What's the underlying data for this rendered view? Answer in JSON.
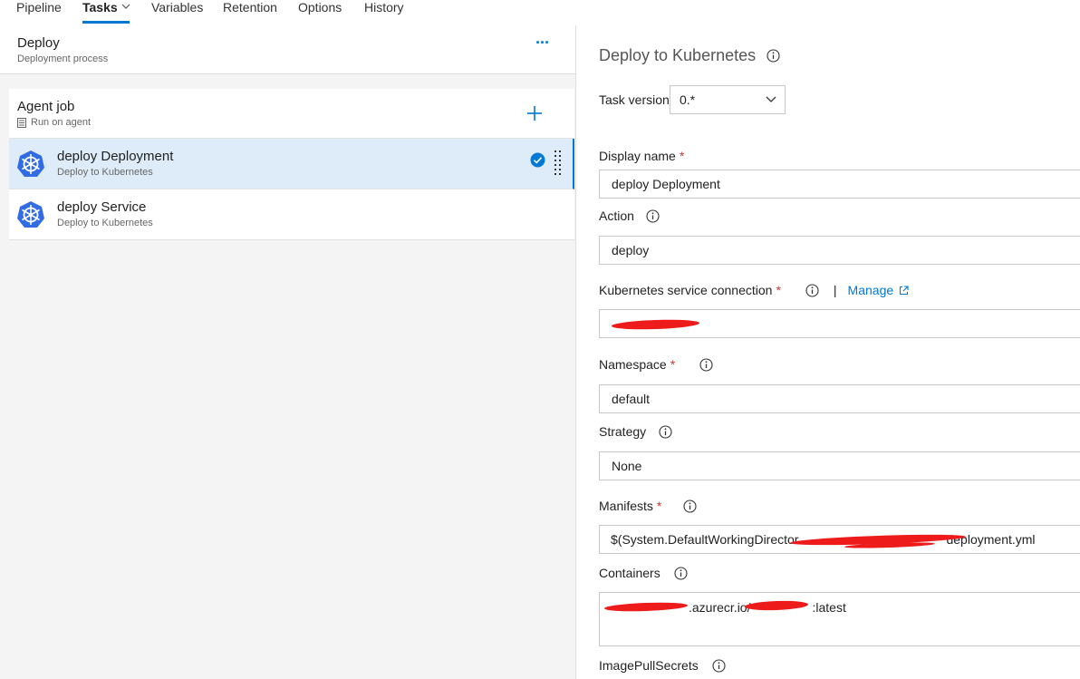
{
  "tabs": [
    {
      "label": "Pipeline",
      "active": false
    },
    {
      "label": "Tasks",
      "active": true
    },
    {
      "label": "Variables",
      "active": false
    },
    {
      "label": "Retention",
      "active": false
    },
    {
      "label": "Options",
      "active": false
    },
    {
      "label": "History",
      "active": false
    }
  ],
  "left": {
    "stage_title": "Deploy",
    "stage_subtitle": "Deployment process",
    "more_label": "···",
    "job": {
      "title": "Agent job",
      "subtitle": "Run on agent"
    },
    "tasks": [
      {
        "title": "deploy Deployment",
        "subtitle": "Deploy to Kubernetes",
        "selected": true
      },
      {
        "title": "deploy Service",
        "subtitle": "Deploy to Kubernetes",
        "selected": false
      }
    ]
  },
  "right": {
    "title": "Deploy to Kubernetes",
    "task_version_label": "Task version",
    "task_version_value": "0.*",
    "display_name_label": "Display name",
    "display_name_value": "deploy Deployment",
    "action_label": "Action",
    "action_value": "deploy",
    "k8s_conn_label": "Kubernetes service connection",
    "manage_label": "Manage",
    "separator": "|",
    "k8s_conn_value": "",
    "namespace_label": "Namespace",
    "namespace_value": "default",
    "strategy_label": "Strategy",
    "strategy_value": "None",
    "manifests_label": "Manifests",
    "manifests_prefix": "$(System.DefaultWorkingDirector",
    "manifests_suffix": "deployment.yml",
    "containers_label": "Containers",
    "containers_mid": ".azurecr.io/",
    "containers_suffix": ":latest",
    "image_pull_label": "ImagePullSecrets",
    "required_mark": "*"
  },
  "colors": {
    "accent": "#0078d4",
    "selected_bg": "#deecf9",
    "required": "#d13438",
    "redaction": "#ee1b1b"
  },
  "icons": [
    "chevron-down-icon",
    "more-icon",
    "add-icon",
    "server-icon",
    "kubernetes-icon",
    "check-circle-icon",
    "drag-handle-icon",
    "info-icon",
    "external-link-icon"
  ]
}
